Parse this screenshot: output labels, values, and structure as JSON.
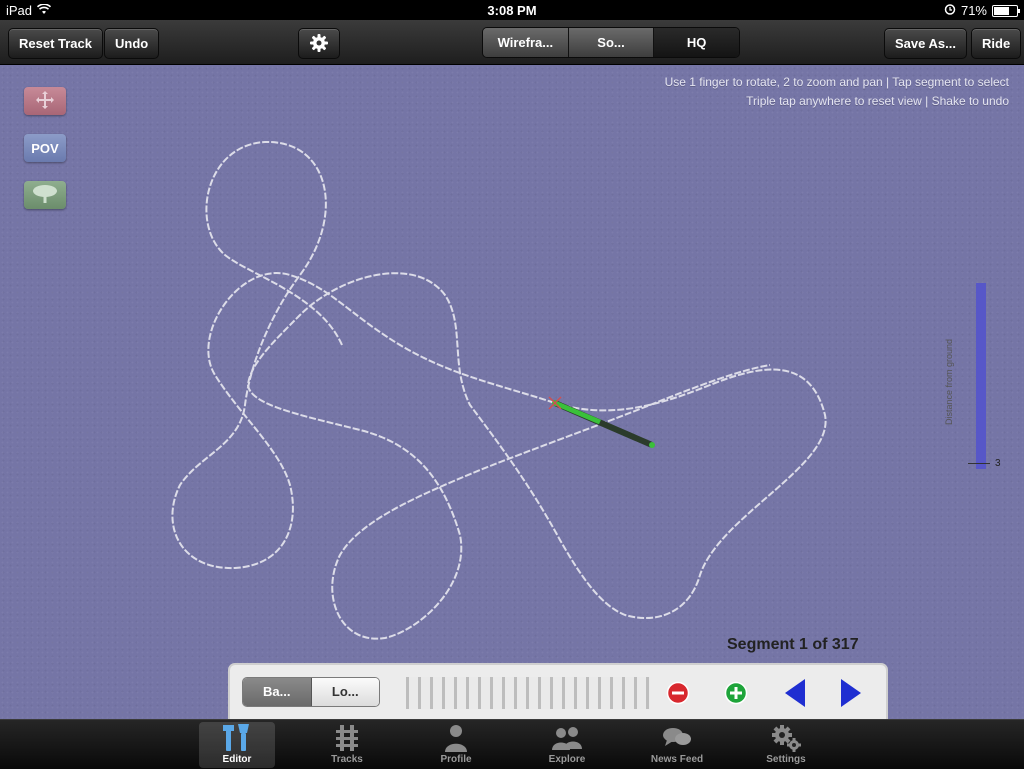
{
  "status_bar": {
    "device": "iPad",
    "time": "3:08 PM",
    "battery": "71%"
  },
  "toolbar": {
    "reset_track": "Reset Track",
    "undo": "Undo",
    "view_modes": [
      "Wirefra...",
      "So...",
      "HQ"
    ],
    "save_as": "Save As...",
    "ride": "Ride"
  },
  "canvas": {
    "hint_line1": "Use 1 finger to rotate, 2 to zoom and pan | Tap segment to select",
    "hint_line2": "Triple tap anywhere to reset view | Shake to undo",
    "side_buttons": {
      "move_icon": "move-icon",
      "pov": "POV",
      "tree_icon": "tree-icon"
    },
    "distance_label": "Distance from ground",
    "distance_value": "3",
    "segment_info": "Segment 1 of 317"
  },
  "controls": {
    "mode_tabs": [
      "Ba...",
      "Lo..."
    ]
  },
  "tabs": [
    {
      "label": "Editor",
      "icon": "tools-icon"
    },
    {
      "label": "Tracks",
      "icon": "track-icon"
    },
    {
      "label": "Profile",
      "icon": "person-icon"
    },
    {
      "label": "Explore",
      "icon": "people-icon"
    },
    {
      "label": "News Feed",
      "icon": "chat-icon"
    },
    {
      "label": "Settings",
      "icon": "gear-icon"
    }
  ],
  "colors": {
    "canvas": "#7575a6",
    "accent_blue": "#1f2ed1"
  }
}
